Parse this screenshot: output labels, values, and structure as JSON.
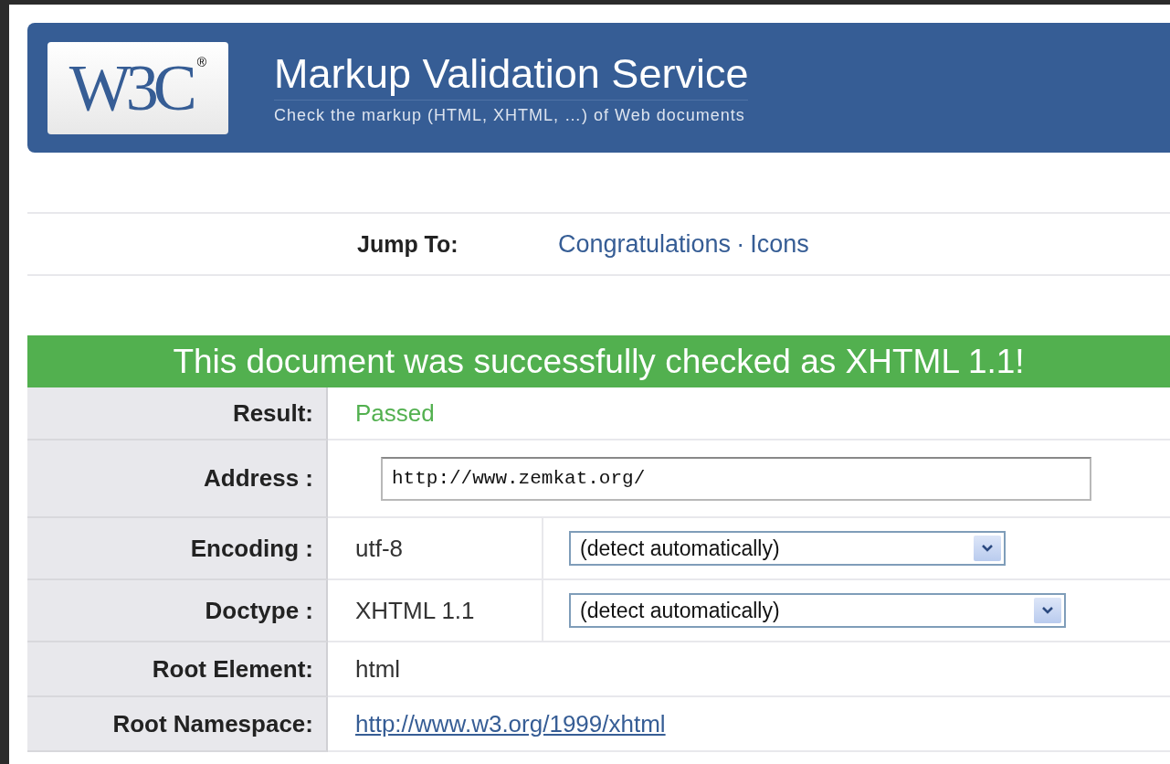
{
  "header": {
    "logo": {
      "text": "W3C",
      "mark": "®"
    },
    "title": "Markup Validation Service",
    "subtitle": "Check the markup (HTML, XHTML, …) of Web documents"
  },
  "jump": {
    "label": "Jump To:",
    "links": [
      "Congratulations",
      "Icons"
    ],
    "separator": "·"
  },
  "banner": "This document was successfully checked as XHTML 1.1!",
  "rows": [
    {
      "kind": "passed",
      "label": "Result:",
      "value": "Passed"
    },
    {
      "kind": "input",
      "label": "Address :",
      "value": "http://www.zemkat.org/"
    },
    {
      "kind": "select",
      "label": "Encoding :",
      "value": "utf-8",
      "option": "(detect automatically)"
    },
    {
      "kind": "select",
      "label": "Doctype :",
      "value": "XHTML 1.1",
      "option": "(detect automatically)"
    },
    {
      "kind": "text",
      "label": "Root Element:",
      "value": "html"
    },
    {
      "kind": "link",
      "label": "Root Namespace:",
      "value": "http://www.w3.org/1999/xhtml"
    }
  ]
}
